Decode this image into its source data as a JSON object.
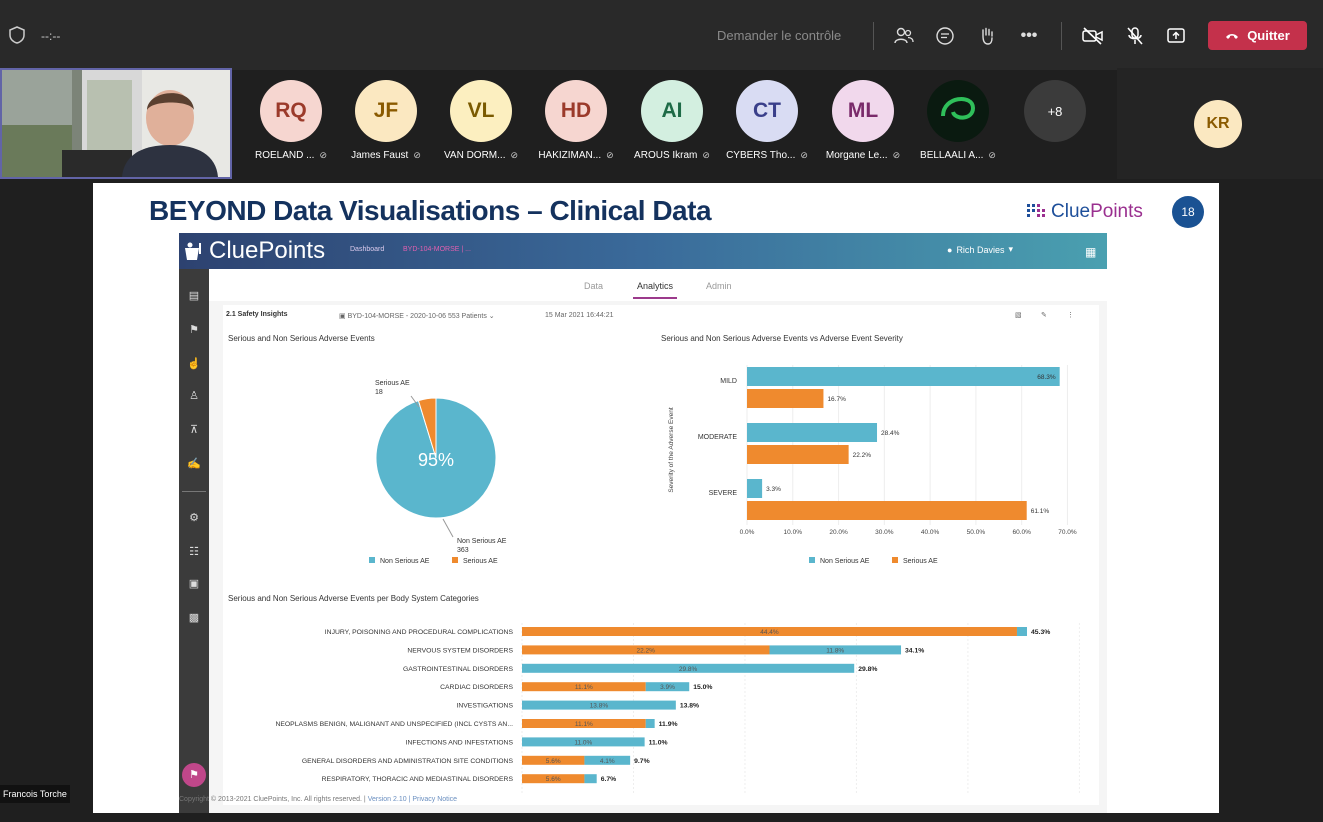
{
  "toolbar": {
    "timer": "--:--",
    "request_control": "Demander le contrôle",
    "quit_label": "Quitter",
    "icons": [
      "shield-icon",
      "people-icon",
      "chat-icon",
      "raise-hand-icon",
      "more-icon",
      "camera-off-icon",
      "mic-off-icon",
      "share-icon",
      "phone-icon"
    ]
  },
  "self_name": "Francois Torche",
  "participants": [
    {
      "initials": "RQ",
      "name": "ROELAND ...",
      "bg": "#f6d6d0",
      "fg": "#9b3a2a"
    },
    {
      "initials": "JF",
      "name": "James Faust",
      "bg": "#fbe8c1",
      "fg": "#8a5a00"
    },
    {
      "initials": "VL",
      "name": "VAN DORM...",
      "bg": "#fcefc0",
      "fg": "#7a5a00"
    },
    {
      "initials": "HD",
      "name": "HAKIZIMAN...",
      "bg": "#f6d6d0",
      "fg": "#9b3a2a"
    },
    {
      "initials": "AI",
      "name": "AROUS Ikram",
      "bg": "#d3efe0",
      "fg": "#1e6b47"
    },
    {
      "initials": "CT",
      "name": "CYBERS Tho...",
      "bg": "#d9dcf3",
      "fg": "#3a3f8a"
    },
    {
      "initials": "ML",
      "name": "Morgane Le...",
      "bg": "#f1d8ec",
      "fg": "#7a2a6a"
    },
    {
      "initials": "",
      "name": "BELLAALI A...",
      "bg": "#0a1a10",
      "fg": "#2fbf5a"
    }
  ],
  "more_count": "+8",
  "extra_participant": "KR",
  "slide": {
    "title": "BEYOND Data Visualisations – Clinical Data",
    "logo_text_a": "Clue",
    "logo_text_b": "Points",
    "page_number": "18",
    "footer_text": "Copyright © 2013-2021 CluePoints, Inc. All rights reserved. |",
    "footer_links": "Version 2.10 | Privacy Notice"
  },
  "app": {
    "logo": "CluePoints",
    "breadcrumb_dashboard": "Dashboard",
    "breadcrumb_study": "BYD-104-MORSE | ...",
    "user": "Rich Davies",
    "tabs": [
      "Data",
      "Analytics",
      "Admin"
    ],
    "active_tab": "Analytics",
    "panel_title": "2.1 Safety Insights",
    "study_select": "BYD-104-MORSE - 2020-10-06 553 Patients",
    "timestamp": "15 Mar 2021 16:44:21",
    "accent": "#9c3a8c"
  },
  "chart_data": [
    {
      "type": "pie",
      "title": "Serious and Non Serious Adverse Events",
      "categories": [
        "Non Serious AE",
        "Serious AE"
      ],
      "values": [
        363,
        18
      ],
      "center_label": "95%",
      "slice_labels": [
        {
          "name": "Non Serious AE",
          "value": "363"
        },
        {
          "name": "Serious AE",
          "value": "18"
        }
      ],
      "colors": [
        "#5ab6cd",
        "#ef8a2e"
      ],
      "legend": "bottom"
    },
    {
      "type": "bar",
      "orientation": "horizontal",
      "title": "Serious and Non Serious Adverse Events vs Adverse Event Severity",
      "ylabel": "Severity of the Adverse Event",
      "categories": [
        "MILD",
        "MODERATE",
        "SEVERE"
      ],
      "series": [
        {
          "name": "Non Serious AE",
          "values": [
            68.3,
            28.4,
            3.3
          ],
          "color": "#5ab6cd"
        },
        {
          "name": "Serious AE",
          "values": [
            16.7,
            22.2,
            61.1
          ],
          "color": "#ef8a2e"
        }
      ],
      "xlim": [
        0,
        70
      ],
      "xticks": [
        "0.0%",
        "10.0%",
        "20.0%",
        "30.0%",
        "40.0%",
        "50.0%",
        "60.0%",
        "70.0%"
      ],
      "legend": "bottom"
    },
    {
      "type": "bar",
      "orientation": "horizontal",
      "stacked": true,
      "title": "Serious and Non Serious Adverse Events per Body System Categories",
      "categories": [
        "INJURY, POISONING AND PROCEDURAL COMPLICATIONS",
        "NERVOUS SYSTEM DISORDERS",
        "GASTROINTESTINAL DISORDERS",
        "CARDIAC DISORDERS",
        "INVESTIGATIONS",
        "NEOPLASMS BENIGN, MALIGNANT AND UNSPECIFIED (INCL CYSTS AN...",
        "INFECTIONS AND INFESTATIONS",
        "GENERAL DISORDERS AND ADMINISTRATION SITE CONDITIONS",
        "RESPIRATORY, THORACIC AND MEDIASTINAL DISORDERS"
      ],
      "series": [
        {
          "name": "Serious AE",
          "values": [
            44.4,
            22.2,
            0,
            11.1,
            0,
            11.1,
            0,
            5.6,
            5.6
          ],
          "color": "#ef8a2e"
        },
        {
          "name": "Non Serious AE",
          "values": [
            0.9,
            11.8,
            29.8,
            3.9,
            13.8,
            0.8,
            11.0,
            4.1,
            1.1
          ],
          "color": "#5ab6cd"
        }
      ],
      "totals": [
        "45.3%",
        "34.1%",
        "29.8%",
        "15.0%",
        "13.8%",
        "11.9%",
        "11.0%",
        "9.7%",
        "6.7%"
      ],
      "xlim": [
        0,
        50
      ]
    }
  ]
}
